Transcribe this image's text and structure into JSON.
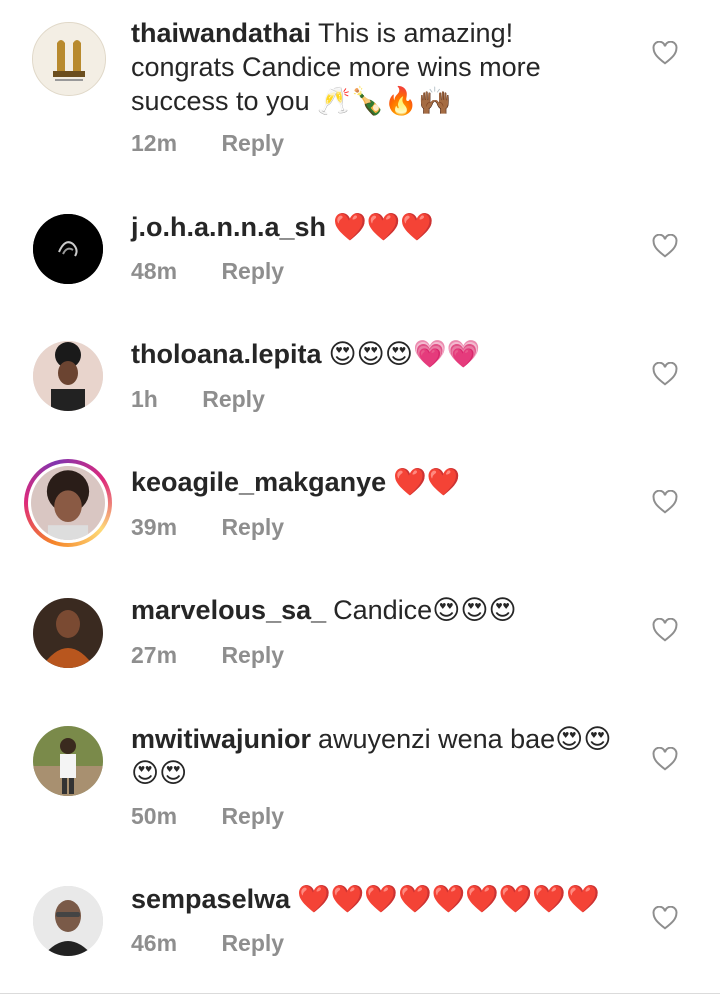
{
  "comments": [
    {
      "username": "thaiwandathai",
      "text_line1": "This is amazing!",
      "text_line2": "congrats Candice more wins more",
      "text_line3": "success to you 🥂🍾🔥🙌🏾",
      "time": "12m",
      "reply": "Reply"
    },
    {
      "username": "j.o.h.a.n.n.a_sh",
      "text": "❤️❤️❤️",
      "time": "48m",
      "reply": "Reply"
    },
    {
      "username": "tholoana.lepita",
      "text": "😍😍😍💗💗",
      "time": "1h",
      "reply": "Reply"
    },
    {
      "username": "keoagile_makganye",
      "text": "❤️❤️",
      "time": "39m",
      "reply": "Reply"
    },
    {
      "username": "marvelous_sa_",
      "text": "Candice😍😍😍",
      "time": "27m",
      "reply": "Reply"
    },
    {
      "username": "mwitiwajunior",
      "text_line1": "awuyenzi wena bae😍😍",
      "text_line2": "😍😍",
      "time": "50m",
      "reply": "Reply"
    },
    {
      "username": "sempaselwa",
      "text": "❤️❤️❤️❤️❤️❤️❤️❤️❤️",
      "time": "46m",
      "reply": "Reply"
    }
  ],
  "icons": {
    "like": "heart-outline-icon"
  },
  "colors": {
    "meta": "#8e8e8e",
    "text": "#262626",
    "story_ring": "#dd2a7b"
  }
}
